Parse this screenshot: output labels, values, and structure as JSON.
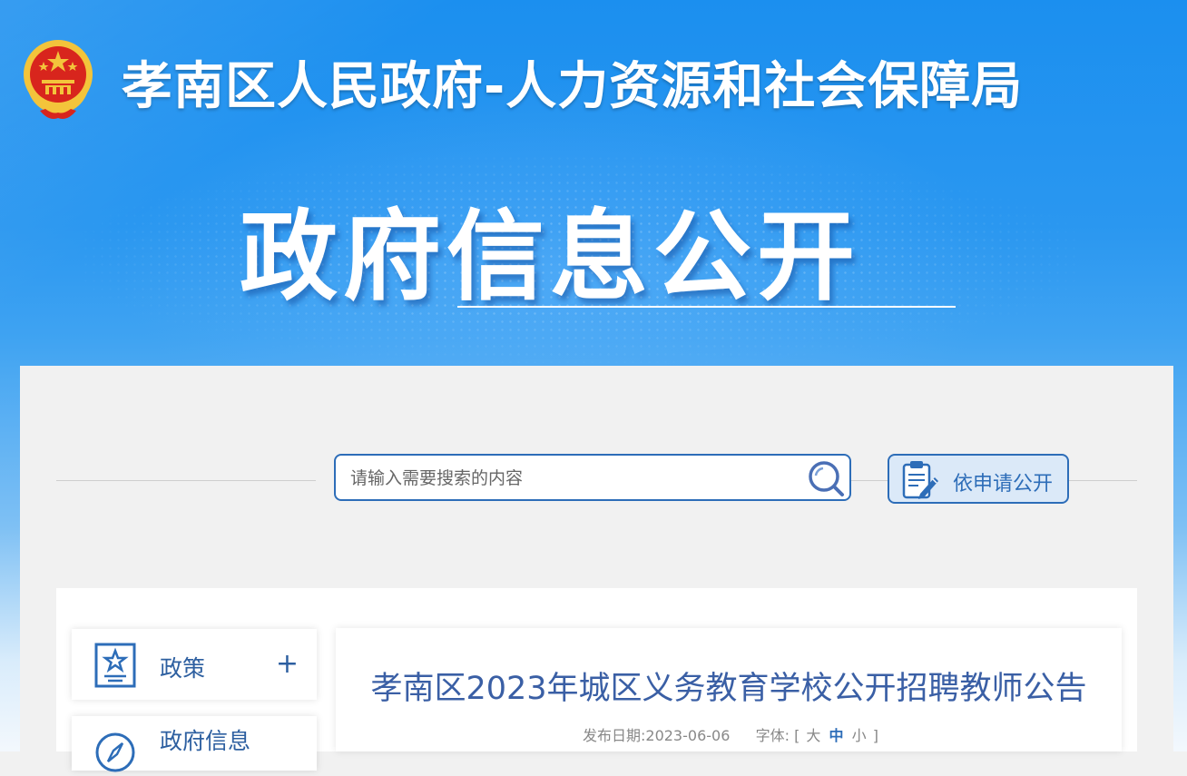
{
  "header": {
    "site_title": "孝南区人民政府-人力资源和社会保障局",
    "section_title": "政府信息公开"
  },
  "search": {
    "placeholder": "请输入需要搜索的内容",
    "value": ""
  },
  "apply_button": {
    "label": "依申请公开"
  },
  "sidebar": {
    "items": [
      {
        "label": "政策",
        "expand": "+"
      },
      {
        "label": "政府信息"
      }
    ]
  },
  "article": {
    "title": "孝南区2023年城区义务教育学校公开招聘教师公告",
    "date_label": "发布日期:2023-06-06",
    "font_label": "字体:",
    "bracket_open": "[",
    "size_large": "大",
    "size_medium": "中",
    "size_small": "小",
    "bracket_close": "]"
  },
  "colors": {
    "banner_blue": "#1b8fef",
    "accent": "#2d6db8",
    "title_blue": "#3a5fa5",
    "emblem_red": "#d8251d",
    "emblem_gold": "#f3c43b"
  }
}
